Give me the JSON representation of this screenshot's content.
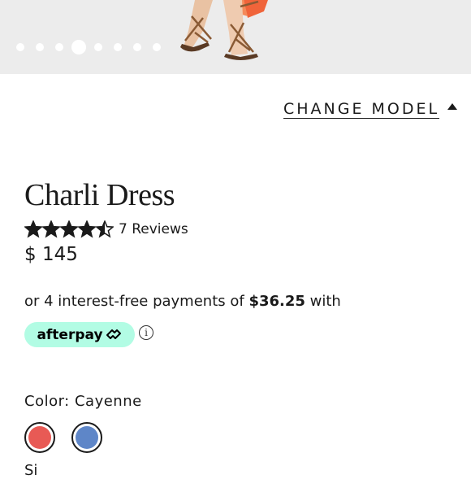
{
  "product": {
    "change_model_label": "CHANGE MODEL",
    "title": "Charli Dress",
    "rating": 4.5,
    "reviews_label": "7 Reviews",
    "price": "$ 145"
  },
  "carousel": {
    "dot_count": 8,
    "active_index": 3
  },
  "afterpay": {
    "line_prefix": "or 4 interest-free payments of",
    "amount": "$36.25",
    "line_suffix": "with",
    "badge_label": "afterpay",
    "badge_color": "#b2fce4",
    "info_icon": "info-icon"
  },
  "color": {
    "label": "Color: Cayenne",
    "swatches": [
      {
        "name": "Cayenne",
        "hex": "#e85a55",
        "selected": true
      },
      {
        "name": "Blue",
        "hex": "#5e86c8",
        "selected": false
      }
    ]
  },
  "size": {
    "label": "Si"
  }
}
